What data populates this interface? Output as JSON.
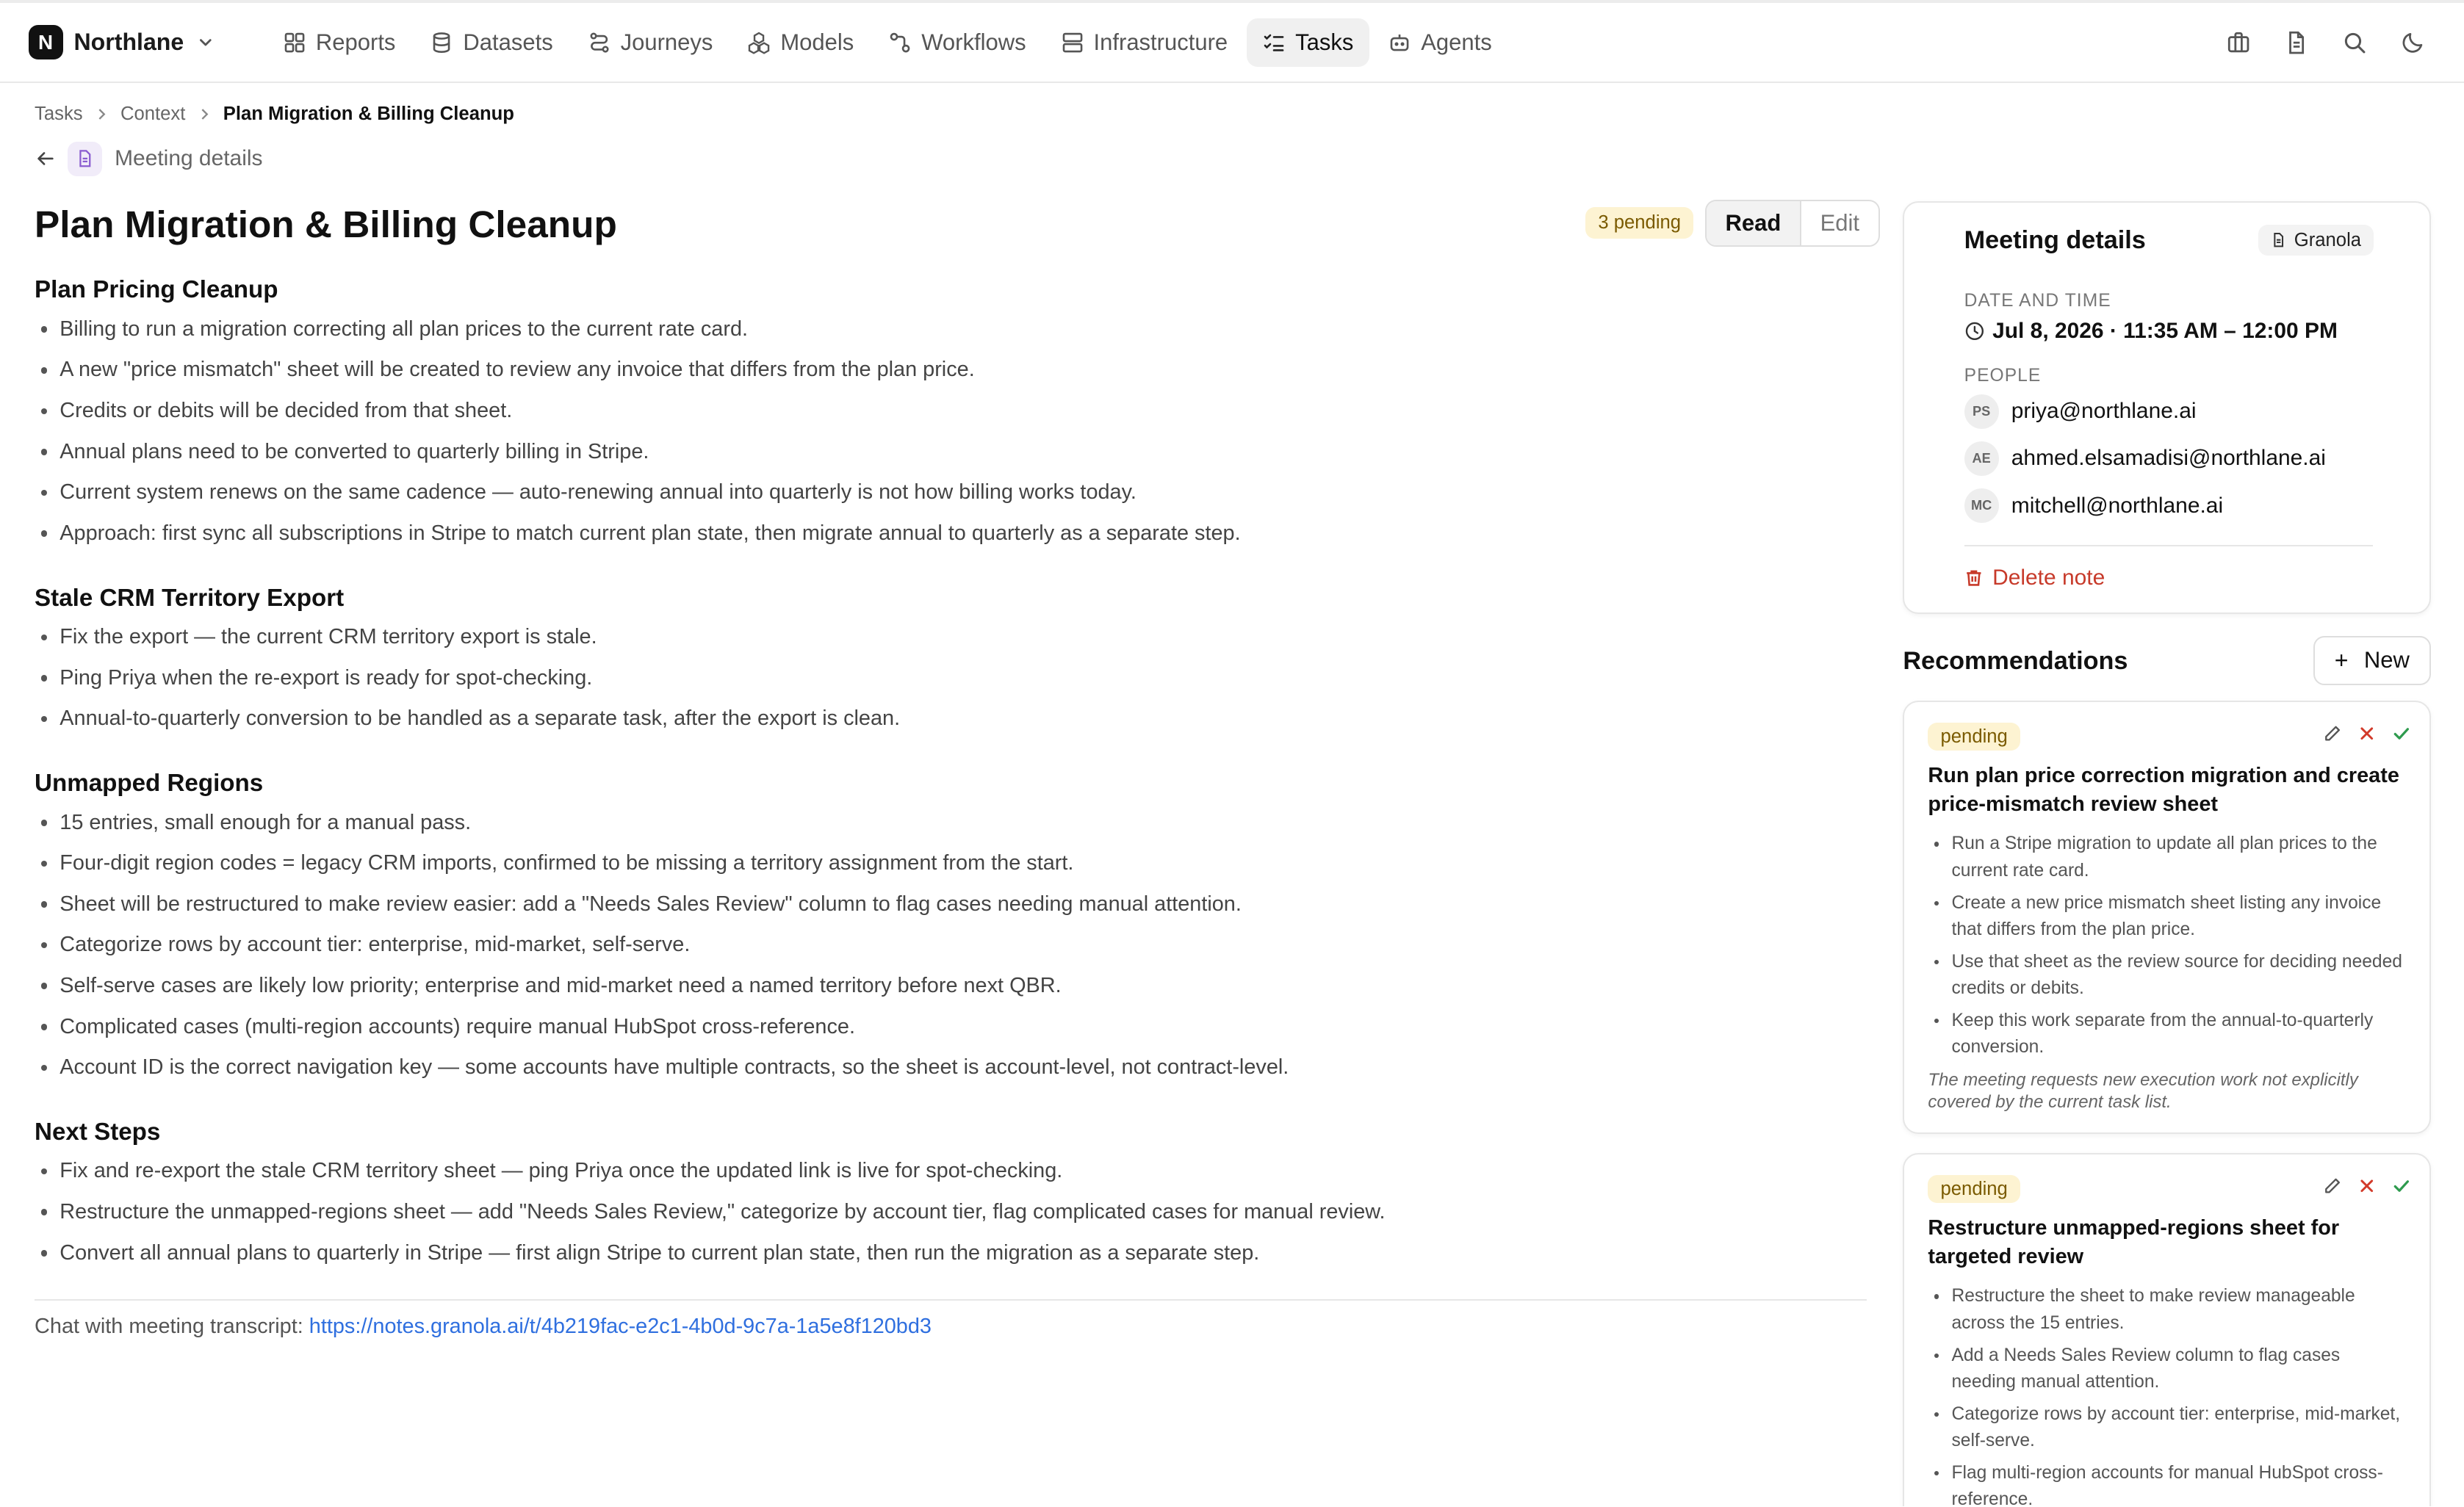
{
  "app": {
    "name": "Northlane",
    "logo_letter": "N"
  },
  "nav": {
    "items": [
      {
        "label": "Reports",
        "icon": "grid-icon"
      },
      {
        "label": "Datasets",
        "icon": "database-icon"
      },
      {
        "label": "Journeys",
        "icon": "route-icon"
      },
      {
        "label": "Models",
        "icon": "cubes-icon"
      },
      {
        "label": "Workflows",
        "icon": "workflow-icon"
      },
      {
        "label": "Infrastructure",
        "icon": "server-icon"
      },
      {
        "label": "Tasks",
        "icon": "checklist-icon",
        "active": true
      },
      {
        "label": "Agents",
        "icon": "bot-icon"
      }
    ],
    "right_icons": [
      "briefcase-icon",
      "document-icon",
      "search-icon",
      "moon-icon"
    ]
  },
  "breadcrumb": {
    "items": [
      "Tasks",
      "Context"
    ],
    "current": "Plan Migration & Billing Cleanup"
  },
  "subheader": {
    "label": "Meeting details"
  },
  "page": {
    "title": "Plan Migration & Billing Cleanup",
    "pending_badge": "3 pending",
    "mode_read": "Read",
    "mode_edit": "Edit"
  },
  "sections": [
    {
      "heading": "Plan Pricing Cleanup",
      "bullets": [
        "Billing to run a migration correcting all plan prices to the current rate card.",
        "A new \"price mismatch\" sheet will be created to review any invoice that differs from the plan price.",
        "Credits or debits will be decided from that sheet.",
        "Annual plans need to be converted to quarterly billing in Stripe.",
        "Current system renews on the same cadence — auto-renewing annual into quarterly is not how billing works today.",
        "Approach: first sync all subscriptions in Stripe to match current plan state, then migrate annual to quarterly as a separate step."
      ]
    },
    {
      "heading": "Stale CRM Territory Export",
      "bullets": [
        "Fix the export — the current CRM territory export is stale.",
        "Ping Priya when the re-export is ready for spot-checking.",
        "Annual-to-quarterly conversion to be handled as a separate task, after the export is clean."
      ]
    },
    {
      "heading": "Unmapped Regions",
      "bullets": [
        "15 entries, small enough for a manual pass.",
        "Four-digit region codes = legacy CRM imports, confirmed to be missing a territory assignment from the start.",
        "Sheet will be restructured to make review easier: add a \"Needs Sales Review\" column to flag cases needing manual attention.",
        "Categorize rows by account tier: enterprise, mid-market, self-serve.",
        "Self-serve cases are likely low priority; enterprise and mid-market need a named territory before next QBR.",
        "Complicated cases (multi-region accounts) require manual HubSpot cross-reference.",
        "Account ID is the correct navigation key — some accounts have multiple contracts, so the sheet is account-level, not contract-level."
      ]
    },
    {
      "heading": "Next Steps",
      "bullets": [
        "Fix and re-export the stale CRM territory sheet — ping Priya once the updated link is live for spot-checking.",
        "Restructure the unmapped-regions sheet — add \"Needs Sales Review,\" categorize by account tier, flag complicated cases for manual review.",
        "Convert all annual plans to quarterly in Stripe — first align Stripe to current plan state, then run the migration as a separate step."
      ]
    }
  ],
  "transcript": {
    "label": "Chat with meeting transcript:",
    "url": "https://notes.granola.ai/t/4b219fac-e2c1-4b0d-9c7a-1a5e8f120bd3"
  },
  "meeting": {
    "title": "Meeting details",
    "source": "Granola",
    "date_label": "DATE AND TIME",
    "datetime": "Jul 8, 2026 · 11:35 AM – 12:00 PM",
    "people_label": "PEOPLE",
    "people": [
      {
        "initials": "PS",
        "email": "priya@northlane.ai"
      },
      {
        "initials": "AE",
        "email": "ahmed.elsamadisi@northlane.ai"
      },
      {
        "initials": "MC",
        "email": "mitchell@northlane.ai"
      }
    ],
    "delete_label": "Delete note"
  },
  "recommendations": {
    "title": "Recommendations",
    "new_label": "New",
    "cards": [
      {
        "status": "pending",
        "title": "Run plan price correction migration and create price-mismatch review sheet",
        "bullets": [
          "Run a Stripe migration to update all plan prices to the current rate card.",
          "Create a new price mismatch sheet listing any invoice that differs from the plan price.",
          "Use that sheet as the review source for deciding needed credits or debits.",
          "Keep this work separate from the annual-to-quarterly conversion."
        ],
        "note": "The meeting requests new execution work not explicitly covered by the current task list."
      },
      {
        "status": "pending",
        "title": "Restructure unmapped-regions sheet for targeted review",
        "bullets": [
          "Restructure the sheet to make review manageable across the 15 entries.",
          "Add a Needs Sales Review column to flag cases needing manual attention.",
          "Categorize rows by account tier: enterprise, mid-market, self-serve.",
          "Flag multi-region accounts for manual HubSpot cross-reference."
        ]
      }
    ]
  },
  "colors": {
    "accent_link": "#2f6fdf",
    "danger": "#c73a2a",
    "pending_bg": "#fdf3d2",
    "pending_text": "#7a5a00",
    "reject": "#d23a2a",
    "accept": "#2e9b4e"
  }
}
